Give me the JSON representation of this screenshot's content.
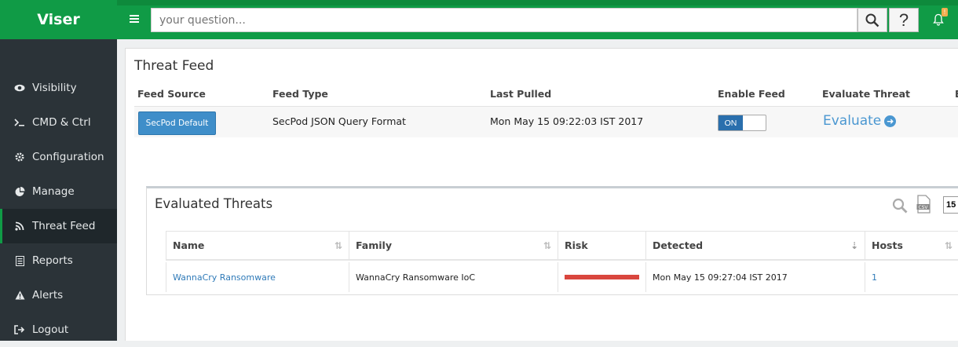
{
  "app": {
    "brand": "Viser"
  },
  "header": {
    "search_placeholder": "your question...",
    "help_label": "?",
    "notification_count": "!"
  },
  "sidebar": {
    "items": [
      {
        "label": "Visibility",
        "icon": "eye-icon"
      },
      {
        "label": "CMD & Ctrl",
        "icon": "terminal-icon"
      },
      {
        "label": "Configuration",
        "icon": "gear-icon"
      },
      {
        "label": "Manage",
        "icon": "pie-chart-icon"
      },
      {
        "label": "Threat Feed",
        "icon": "rss-icon",
        "active": true
      },
      {
        "label": "Reports",
        "icon": "list-icon"
      },
      {
        "label": "Alerts",
        "icon": "warning-icon"
      },
      {
        "label": "Logout",
        "icon": "logout-icon"
      }
    ]
  },
  "page": {
    "title": "Threat Feed"
  },
  "feed_table": {
    "headers": [
      "Feed Source",
      "Feed Type",
      "Last Pulled",
      "Enable Feed",
      "Evaluate Threat",
      "E"
    ],
    "row": {
      "source_button": "SecPod Default",
      "type": "SecPod JSON Query Format",
      "last_pulled": "Mon May 15 09:22:03 IST 2017",
      "toggle_label": "ON",
      "evaluate_label": "Evaluate"
    }
  },
  "evaluated": {
    "title": "Evaluated Threats",
    "page_size": "15",
    "headers": [
      "Name",
      "Family",
      "Risk",
      "Detected",
      "Hosts"
    ],
    "rows": [
      {
        "name": "WannaCry Ransomware",
        "family": "WannaCry Ransomware IoC",
        "risk_level": 1.0,
        "detected": "Mon May 15 09:27:04 IST 2017",
        "hosts": "1"
      }
    ]
  },
  "colors": {
    "brand_green": "#109b46",
    "sidebar": "#2b3338",
    "link": "#2f7ab8",
    "risk": "#d9463e"
  }
}
